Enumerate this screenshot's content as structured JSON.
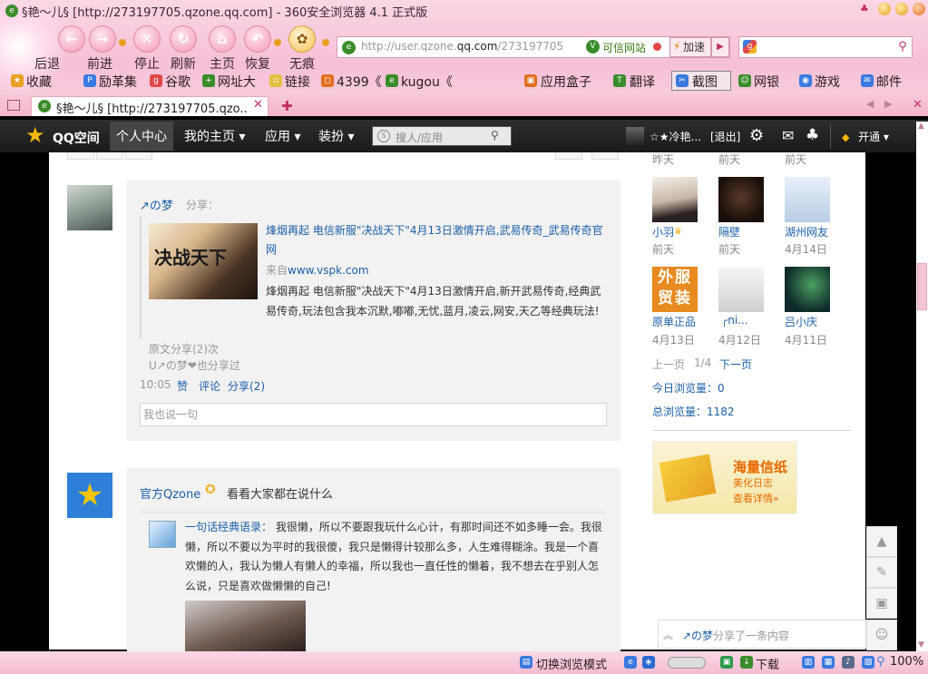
{
  "window": {
    "title": "§艳～儿§ [http://273197705.qzone.qq.com] - 360安全浏览器 4.1 正式版"
  },
  "toolbar": {
    "back": "后退",
    "forward": "前进",
    "stop": "停止",
    "refresh": "刷新",
    "home": "主页",
    "restore": "恢复",
    "incognito": "无痕"
  },
  "address": {
    "url_prefix": "http://user.qzone.",
    "url_domain": "qq.com",
    "url_suffix": "/273197705",
    "trusted": "可信网站",
    "speed": "加速"
  },
  "favorites": [
    "收藏",
    "励革集",
    "谷歌",
    "网址大",
    "链接",
    "4399《",
    "kugou《"
  ],
  "tools": [
    "应用盒子",
    "翻译",
    "截图",
    "网银",
    "游戏",
    "邮件"
  ],
  "tab": {
    "title": "§艳～儿§ [http://273197705.qzo..."
  },
  "qqnav": {
    "brand": "QQ空间",
    "items": [
      "个人中心",
      "我的主页",
      "应用",
      "装扮"
    ],
    "search_placeholder": "搜人/应用",
    "nick": "☆★冷艳...",
    "logout": "[退出]",
    "vip": "开通"
  },
  "feed": {
    "post1": {
      "author": "↗の梦",
      "action": "分享：",
      "headline": "烽烟再起 电信新服\"决战天下\"4月13日激情开启,武易传奇_武易传奇官网",
      "source_label": "来自",
      "source": "www.vspk.com",
      "desc": "烽烟再起 电信新服\"决战天下\"4月13日激情开启,新开武易传奇,经典武易传奇,玩法包含我本沉默,嘟嘟,无忧,蓝月,凌云,网安,天乙等经典玩法!",
      "original_share": "原文分享(2)次",
      "also_shared": "U↗の梦❤也分享过",
      "time": "10:05",
      "like": "赞",
      "comment": "评论",
      "share": "分享(2)",
      "reply_placeholder": "我也说一句",
      "thumb_text": "决战天下"
    },
    "post2": {
      "author": "官方Qzone",
      "action": "看看大家都在说什么",
      "quote_source": "一句话经典语录：",
      "quote": "我很懒，所以不要跟我玩什么心计，有那时间还不如多睡一会。我很懒，所以不要以为平时的我很傻，我只是懒得计较那么多，人生难得糊涂。我是一个喜欢懒的人，我认为懒人有懒人的幸福，所以我也一直任性的懒着，我不想去在乎别人怎么说，只是喜欢做懒懒的自己!"
    }
  },
  "sidebar": {
    "top_times": [
      "昨天",
      "前天",
      "前天"
    ],
    "friends": [
      {
        "name": "小羽",
        "time": "前天"
      },
      {
        "name": "隔壁",
        "time": "前天"
      },
      {
        "name": "湖州网友",
        "time": "4月14日"
      },
      {
        "name": "原单正品",
        "time": "4月13日"
      },
      {
        "name": "╭ni...",
        "time": "4月12日"
      },
      {
        "name": "吕小庆",
        "time": "4月11日"
      }
    ],
    "prev": "上一页",
    "page": "1/4",
    "next": "下一页",
    "today_label": "今日浏览量：",
    "today_value": "0",
    "total_label": "总浏览量：",
    "total_value": "1182",
    "banner_title": "海量信纸",
    "banner_sub": "美化日志",
    "banner_link": "查看详情»",
    "tile_text": "外服贸装"
  },
  "notify": {
    "name": "↗の梦",
    "text": "分享了一条内容"
  },
  "statusbar": {
    "switch_mode": "切换浏览模式",
    "download": "下载",
    "zoom": "100%"
  }
}
